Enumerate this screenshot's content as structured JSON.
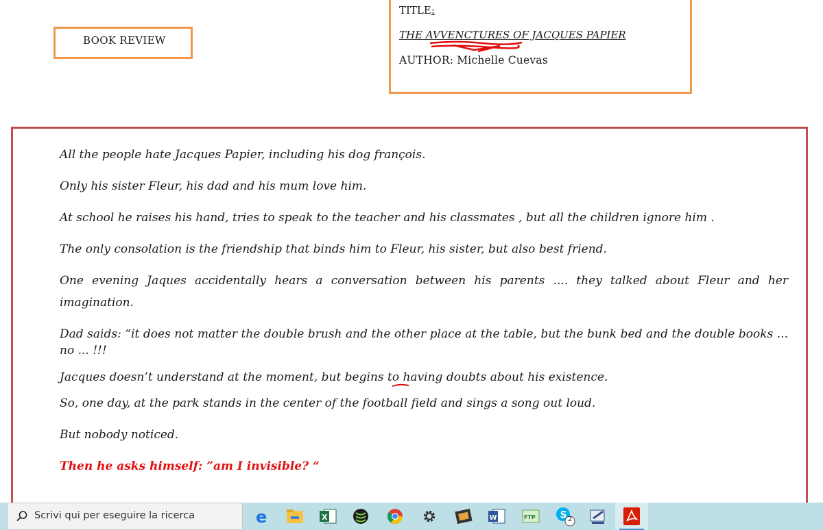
{
  "review_box": {
    "label": "BOOK REVIEW"
  },
  "title_box": {
    "title_label": "TITLE",
    "title_colon": ":",
    "book_title": "THE AVVENCTURES OF JACQUES PAPIER",
    "author_line": "AUTHOR:  Michelle Cuevas"
  },
  "review": {
    "paragraphs": [
      "All the people  hate  Jacques  Papier, including his dog françois.",
      " Only his sister Fleur, his dad and his mum love him.",
      "At school he raises his hand, tries to speak to the teacher and his classmates , but  all the children  ignore him  .",
      "The only  consolation  is the friendship  that  binds  him to Fleur, his sister, but also best friend.",
      "One  evening   Jaques  accidentally   hears  a  conversation  between  his  parents  ....  they  talked  about  Fleur  and  her imagination.",
      " Dad saids: “it does not matter the double brush  and  the other place at the table, but the bunk bed and the double books ... no ... !!!",
      " Jacques doesn’t understand  at the moment, but  begins to having doubts about his  existence.",
      " So, one day, at the park  stands in the center of  the  football field and sings a song out loud.",
      "But nobody noticed.",
      "Then he asks himself: ”am I invisible? “"
    ]
  },
  "taskbar": {
    "search_placeholder": "Scrivi qui per eseguire la ricerca",
    "skype_badge": "2",
    "icons": [
      "edge-icon",
      "file-explorer-icon",
      "excel-icon",
      "media-app-icon",
      "chrome-icon",
      "settings-icon",
      "video-app-icon",
      "word-icon",
      "ftp-app-icon",
      "skype-icon",
      "drawing-app-icon",
      "acrobat-icon"
    ],
    "colors": {
      "bar": "#bfdfe6",
      "search": "#f2f2f2",
      "active": "#d9ecf0"
    }
  },
  "colors": {
    "orange_border": "#f0974a",
    "red_border": "#c0504d",
    "red_text": "#e01010",
    "spell_underline": "#e01010"
  }
}
